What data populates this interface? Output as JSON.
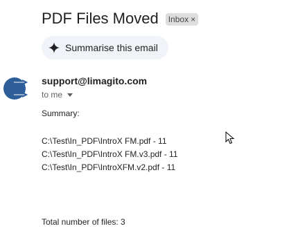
{
  "email": {
    "subject": "PDF Files Moved",
    "label": "Inbox",
    "label_remove": "×",
    "summarise_label": "Summarise this email",
    "sender": "support@limagito.com",
    "recipient": "to me",
    "body": {
      "heading": "Summary:",
      "files": [
        "C:\\Test\\In_PDF\\IntroX FM.pdf - 11",
        "C:\\Test\\In_PDF\\IntroX FM.v3.pdf - 11",
        "C:\\Test\\In_PDF\\IntroXFM.v2.pdf - 11"
      ],
      "total": "Total number of files: 3"
    }
  },
  "icons": {
    "sparkle": "sparkle-icon",
    "avatar": "limagito-logo-avatar",
    "caret": "caret-down-icon",
    "cursor": "mouse-pointer-icon"
  },
  "colors": {
    "avatar_blue": "#2d5e9a",
    "chip_bg": "#dddddd",
    "summarise_bg": "#f0f4f9"
  }
}
